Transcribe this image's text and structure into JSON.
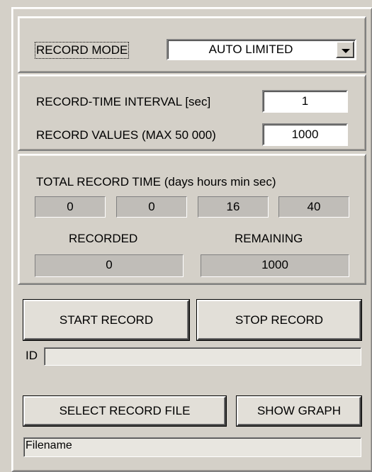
{
  "record_mode": {
    "label": "RECORD MODE",
    "selected": "AUTO LIMITED"
  },
  "interval": {
    "label": "RECORD-TIME INTERVAL [sec]",
    "value": "1"
  },
  "values": {
    "label": "RECORD VALUES (MAX 50 000)",
    "value": "1000"
  },
  "total_time": {
    "label": "TOTAL RECORD TIME (days  hours  min sec)",
    "days": "0",
    "hours": "0",
    "min": "16",
    "sec": "40"
  },
  "recorded": {
    "label": "RECORDED",
    "value": "0"
  },
  "remaining": {
    "label": "REMAINING",
    "value": "1000"
  },
  "buttons": {
    "start": "START RECORD",
    "stop": "STOP RECORD",
    "select_file": "SELECT RECORD FILE",
    "show_graph": "SHOW GRAPH"
  },
  "id_field": {
    "label": "ID",
    "value": ""
  },
  "filename": {
    "value": "Filename"
  }
}
